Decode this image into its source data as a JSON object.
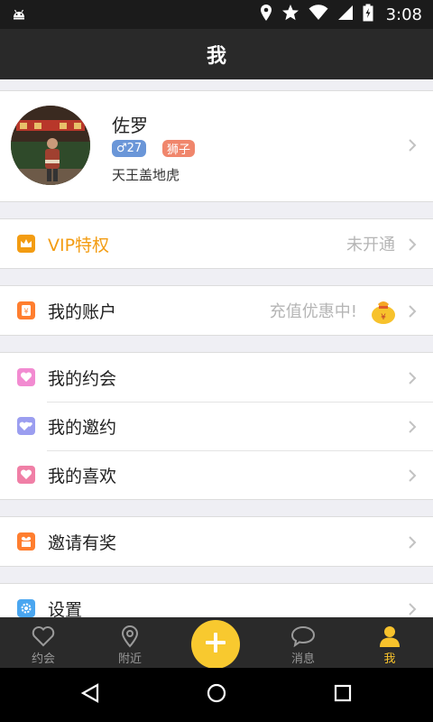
{
  "status_bar": {
    "time": "3:08",
    "icons": [
      "android-icon",
      "location-icon",
      "star-icon",
      "wifi-icon",
      "signal-icon",
      "battery-icon"
    ]
  },
  "title": "我",
  "profile": {
    "name": "佐罗",
    "gender_age": "♂27",
    "zodiac": "狮子",
    "signature": "天王盖地虎"
  },
  "menu": {
    "vip": {
      "label": "VIP特权",
      "value": "未开通",
      "icon": "crown-icon",
      "color": "#f39c12"
    },
    "account": {
      "label": "我的账户",
      "value": "充值优惠中!",
      "icon": "wallet-icon",
      "color": "#ff7e2f"
    },
    "dating": [
      {
        "label": "我的约会",
        "icon": "heart-icon",
        "color": "#f28bd1"
      },
      {
        "label": "我的邀约",
        "icon": "hearts-icon",
        "color": "#9b9ef0"
      },
      {
        "label": "我的喜欢",
        "icon": "heart-icon",
        "color": "#f07fa6"
      }
    ],
    "invite": {
      "label": "邀请有奖",
      "icon": "gift-icon",
      "color": "#ff7e2f"
    },
    "settings": {
      "label": "设置",
      "icon": "gear-icon",
      "color": "#4aa6f0"
    }
  },
  "tab_bar": {
    "tabs": [
      {
        "label": "约会",
        "icon": "heart-outline-icon"
      },
      {
        "label": "附近",
        "icon": "location-outline-icon"
      },
      {
        "label": "消息",
        "icon": "chat-icon"
      },
      {
        "label": "我",
        "icon": "person-icon",
        "active": true
      }
    ],
    "accent": "#f7c22c"
  }
}
